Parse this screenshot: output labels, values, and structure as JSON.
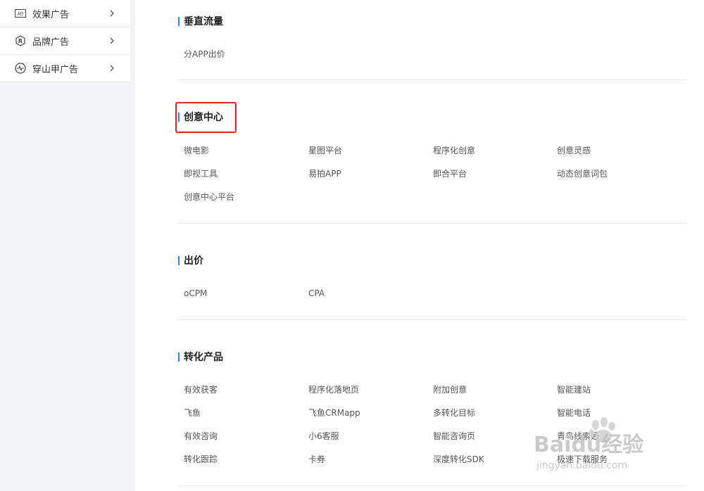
{
  "sidebar": {
    "items": [
      {
        "label": "效果广告",
        "icon": "ad-icon"
      },
      {
        "label": "品牌广告",
        "icon": "registered-icon"
      },
      {
        "label": "穿山甲广告",
        "icon": "pulse-icon"
      }
    ]
  },
  "sections": [
    {
      "title": "垂直流量",
      "items": [
        "分APP出价"
      ]
    },
    {
      "title": "创意中心",
      "items": [
        "微电影",
        "星图平台",
        "程序化创意",
        "创意灵感",
        "即视工具",
        "易拍APP",
        "即合平台",
        "动态创意词包",
        "创意中心平台"
      ]
    },
    {
      "title": "出价",
      "items": [
        "oCPM",
        "CPA"
      ]
    },
    {
      "title": "转化产品",
      "items": [
        "有效获客",
        "程序化落地页",
        "附加创意",
        "智能建站",
        "飞鱼",
        "飞鱼CRMapp",
        "多转化目标",
        "智能电话",
        "有效咨询",
        "小6客服",
        "智能咨询页",
        "青鸟线索通",
        "转化跟踪",
        "卡券",
        "深度转化SDK",
        "极速下载服务"
      ]
    }
  ],
  "watermark": {
    "brand": "Baidu经验",
    "url": "jingyan.baidu.com"
  },
  "colors": {
    "accent": "#2f7df6",
    "highlight": "#e0261e"
  }
}
